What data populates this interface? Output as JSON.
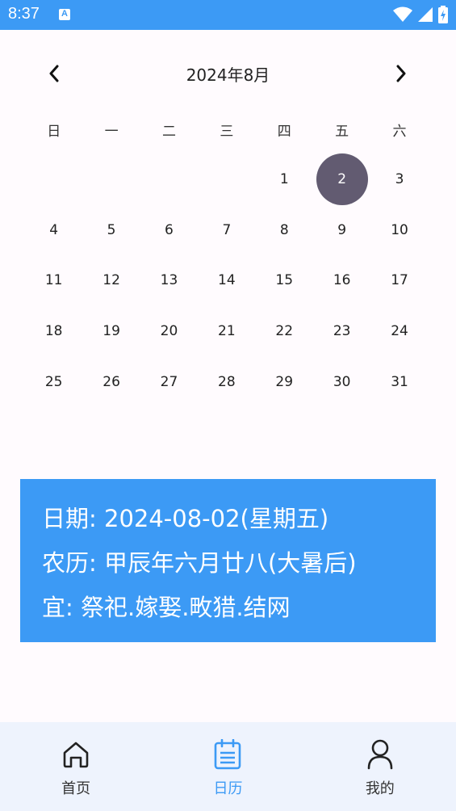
{
  "status_bar": {
    "time": "8:37",
    "notification_letter": "A"
  },
  "calendar": {
    "month_title": "2024年8月",
    "weekdays": [
      "日",
      "一",
      "二",
      "三",
      "四",
      "五",
      "六"
    ],
    "days": [
      "",
      "",
      "",
      "",
      "1",
      "2",
      "3",
      "4",
      "5",
      "6",
      "7",
      "8",
      "9",
      "10",
      "11",
      "12",
      "13",
      "14",
      "15",
      "16",
      "17",
      "18",
      "19",
      "20",
      "21",
      "22",
      "23",
      "24",
      "25",
      "26",
      "27",
      "28",
      "29",
      "30",
      "31"
    ],
    "selected_day": "2"
  },
  "info": {
    "date_line": "日期: 2024-08-02(星期五)",
    "lunar_line": "农历: 甲辰年六月廿八(大暑后)",
    "yi_line": "宜: 祭祀.嫁娶.畋猎.结网"
  },
  "bottom_nav": {
    "items": [
      {
        "label": "首页",
        "icon": "home-icon"
      },
      {
        "label": "日历",
        "icon": "calendar-icon"
      },
      {
        "label": "我的",
        "icon": "person-icon"
      }
    ],
    "active_index": 1
  },
  "colors": {
    "accent": "#3c9af5",
    "selected_day_bg": "#625b71",
    "nav_bg": "#eef3fd"
  }
}
